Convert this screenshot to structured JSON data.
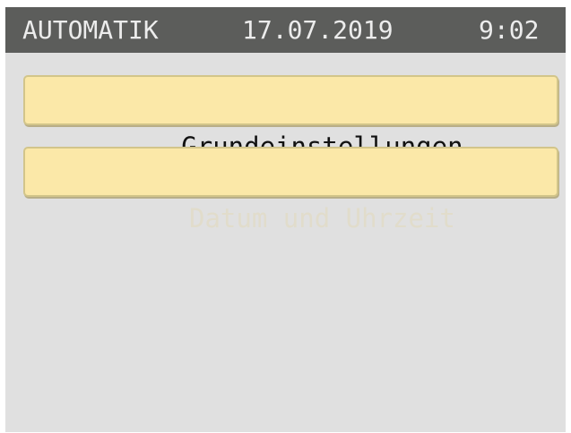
{
  "status_bar": {
    "mode": "AUTOMATIK",
    "date": "17.07.2019",
    "time": "9:02"
  },
  "menu": {
    "items": [
      {
        "label": "Grundeinstellungen",
        "enabled": true
      },
      {
        "label": "Datum und Uhrzeit",
        "enabled": false
      }
    ]
  },
  "colors": {
    "status_bar_bg": "#5c5d5b",
    "status_bar_text": "#ececec",
    "screen_bg": "#e0e0e0",
    "button_bg": "#fbe8a8",
    "button_border": "#d2c58a",
    "button_text": "#111111",
    "button_text_disabled": "#e1dccb"
  }
}
